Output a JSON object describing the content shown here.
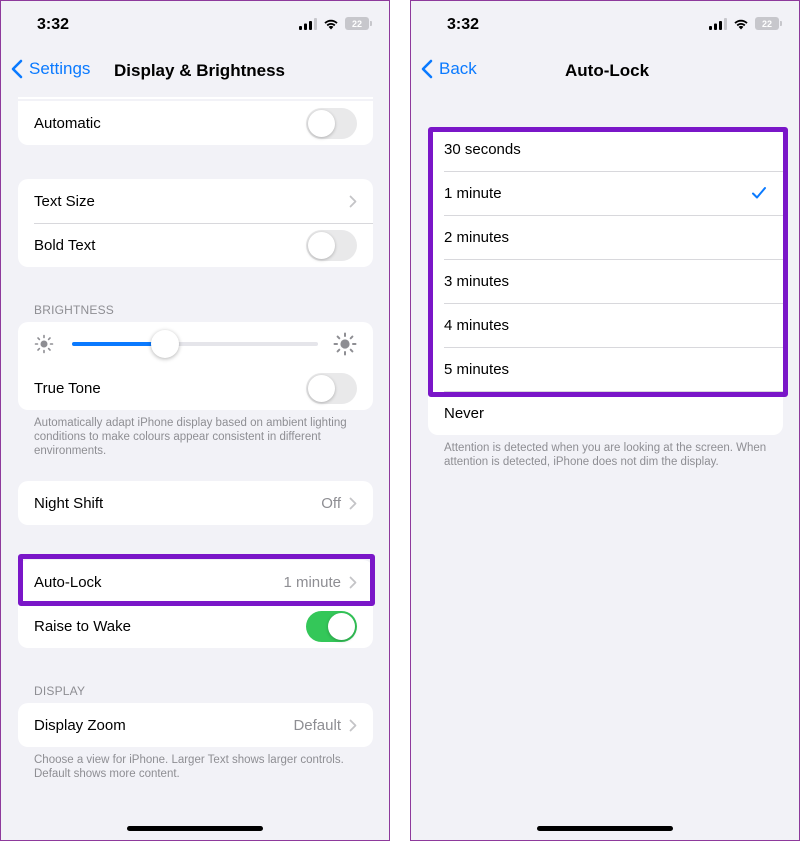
{
  "left": {
    "status": {
      "time": "3:32",
      "battery": "22"
    },
    "nav": {
      "back_label": "Settings",
      "title": "Display & Brightness"
    },
    "appearance": {
      "automatic_label": "Automatic",
      "automatic_on": false
    },
    "text": {
      "text_size_label": "Text Size",
      "bold_text_label": "Bold Text",
      "bold_text_on": false
    },
    "brightness": {
      "header": "BRIGHTNESS",
      "level": 0.38,
      "true_tone_label": "True Tone",
      "true_tone_on": false,
      "footnote": "Automatically adapt iPhone display based on ambient lighting conditions to make colours appear consistent in different environments."
    },
    "night_shift": {
      "label": "Night Shift",
      "value": "Off"
    },
    "lock": {
      "auto_lock_label": "Auto-Lock",
      "auto_lock_value": "1 minute",
      "raise_to_wake_label": "Raise to Wake",
      "raise_to_wake_on": true
    },
    "display": {
      "header": "DISPLAY",
      "zoom_label": "Display Zoom",
      "zoom_value": "Default",
      "footnote": "Choose a view for iPhone. Larger Text shows larger controls. Default shows more content."
    }
  },
  "right": {
    "status": {
      "time": "3:32",
      "battery": "22"
    },
    "nav": {
      "back_label": "Back",
      "title": "Auto-Lock"
    },
    "options": [
      {
        "label": "30 seconds",
        "selected": false
      },
      {
        "label": "1 minute",
        "selected": true
      },
      {
        "label": "2 minutes",
        "selected": false
      },
      {
        "label": "3 minutes",
        "selected": false
      },
      {
        "label": "4 minutes",
        "selected": false
      },
      {
        "label": "5 minutes",
        "selected": false
      },
      {
        "label": "Never",
        "selected": false
      }
    ],
    "footnote": "Attention is detected when you are looking at the screen. When attention is detected, iPhone does not dim the display."
  },
  "colors": {
    "accent": "#0a7aff",
    "toggle_on": "#34c759",
    "highlight": "#7a16c8",
    "background": "#f2f2f7"
  }
}
